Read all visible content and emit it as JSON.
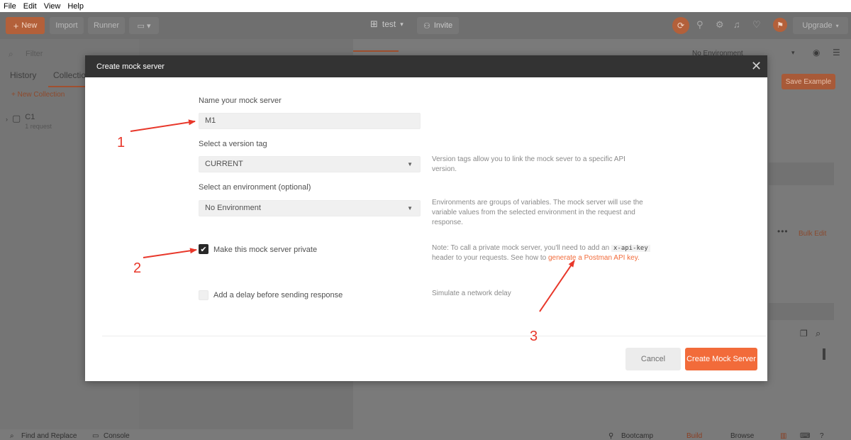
{
  "menu": [
    "File",
    "Edit",
    "View",
    "Help"
  ],
  "header": {
    "new_label": "New",
    "import_label": "Import",
    "runner_label": "Runner",
    "workspace": "test",
    "invite_label": "Invite",
    "upgrade_label": "Upgrade"
  },
  "sidebar": {
    "filter_placeholder": "Filter",
    "tab_history": "History",
    "tab_collections": "Collectio",
    "new_collection": "+ New Collection",
    "collection_name": "C1",
    "collection_sub": "1 request"
  },
  "right": {
    "environment": "No Environment",
    "save_example": "Save Example",
    "bulk_edit": "Bulk Edit"
  },
  "statusbar": {
    "find_replace": "Find and Replace",
    "console": "Console",
    "bootcamp": "Bootcamp",
    "build": "Build",
    "browse": "Browse"
  },
  "modal": {
    "title": "Create mock server",
    "name_label": "Name your mock server",
    "name_value": "M1",
    "version_label": "Select a version tag",
    "version_value": "CURRENT",
    "version_help": "Version tags allow you to link the mock sever to a specific API version.",
    "env_label": "Select an environment (optional)",
    "env_value": "No Environment",
    "env_help": "Environments are groups of variables. The mock server will use the variable values from the selected environment in the request and response.",
    "private_label": "Make this mock server private",
    "private_checked": true,
    "private_help_pre": "Note: To call a private mock server, you'll need to add an",
    "private_help_code": "x-api-key",
    "private_help_mid": "header to your requests. See how to",
    "private_help_link": "generate a Postman API key.",
    "delay_label": "Add a delay before sending response",
    "delay_checked": false,
    "delay_help": "Simulate a network delay",
    "cancel_label": "Cancel",
    "create_label": "Create Mock Server"
  },
  "annotations": [
    "1",
    "2",
    "3"
  ],
  "colors": {
    "accent": "#f26b3a",
    "annotation": "#e8372a",
    "modal_header": "#333333"
  }
}
